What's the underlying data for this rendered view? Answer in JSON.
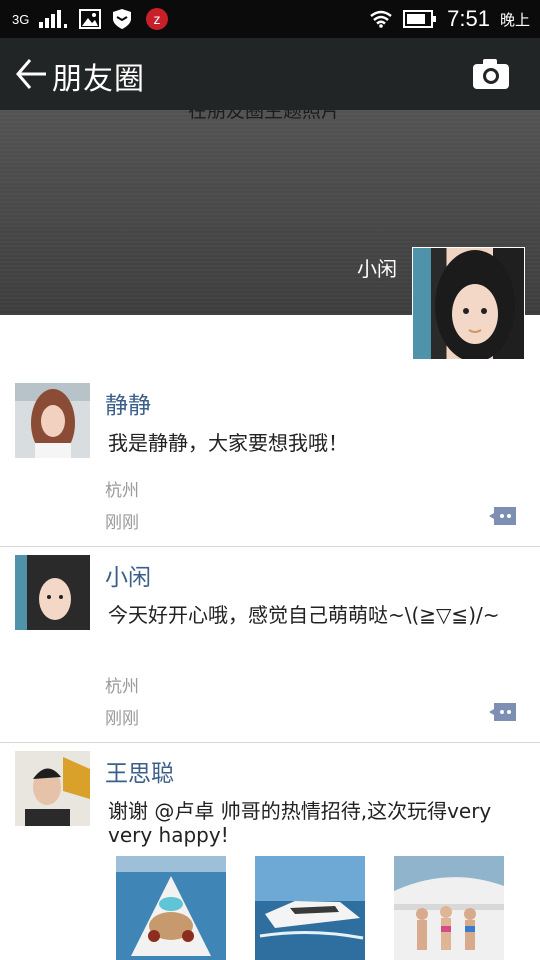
{
  "status_bar": {
    "network": "3G",
    "time": "7:51",
    "ampm": "晚上",
    "icons": [
      "signal-icon",
      "image-icon",
      "shield-icon",
      "app-z-icon",
      "wifi-icon",
      "battery-icon"
    ]
  },
  "header": {
    "title": "朋友圈",
    "back_icon": "arrow-left-icon",
    "camera_icon": "camera-icon"
  },
  "cover": {
    "partial_text": "在朋友圈主题照片",
    "owner_name": "小闲"
  },
  "posts": [
    {
      "name": "静静",
      "text": "我是静静，大家要想我哦！",
      "location": "杭州",
      "time": "刚刚"
    },
    {
      "name": "小闲",
      "text": "今天好开心哦，感觉自己萌萌哒~\\(≧▽≦)/~",
      "location": "杭州",
      "time": "刚刚"
    },
    {
      "name": "王思聪",
      "text": "谢谢 @卢卓 帅哥的热情招待,这次玩得very very happy!",
      "images": [
        "yacht-deck-photo",
        "speedboat-photo",
        "yacht-party-photo"
      ]
    }
  ],
  "colors": {
    "name_blue": "#3c5f8a",
    "header_bg": "#222526",
    "status_bg": "#0b0b0b",
    "comment_icon": "#7d8fb3"
  }
}
